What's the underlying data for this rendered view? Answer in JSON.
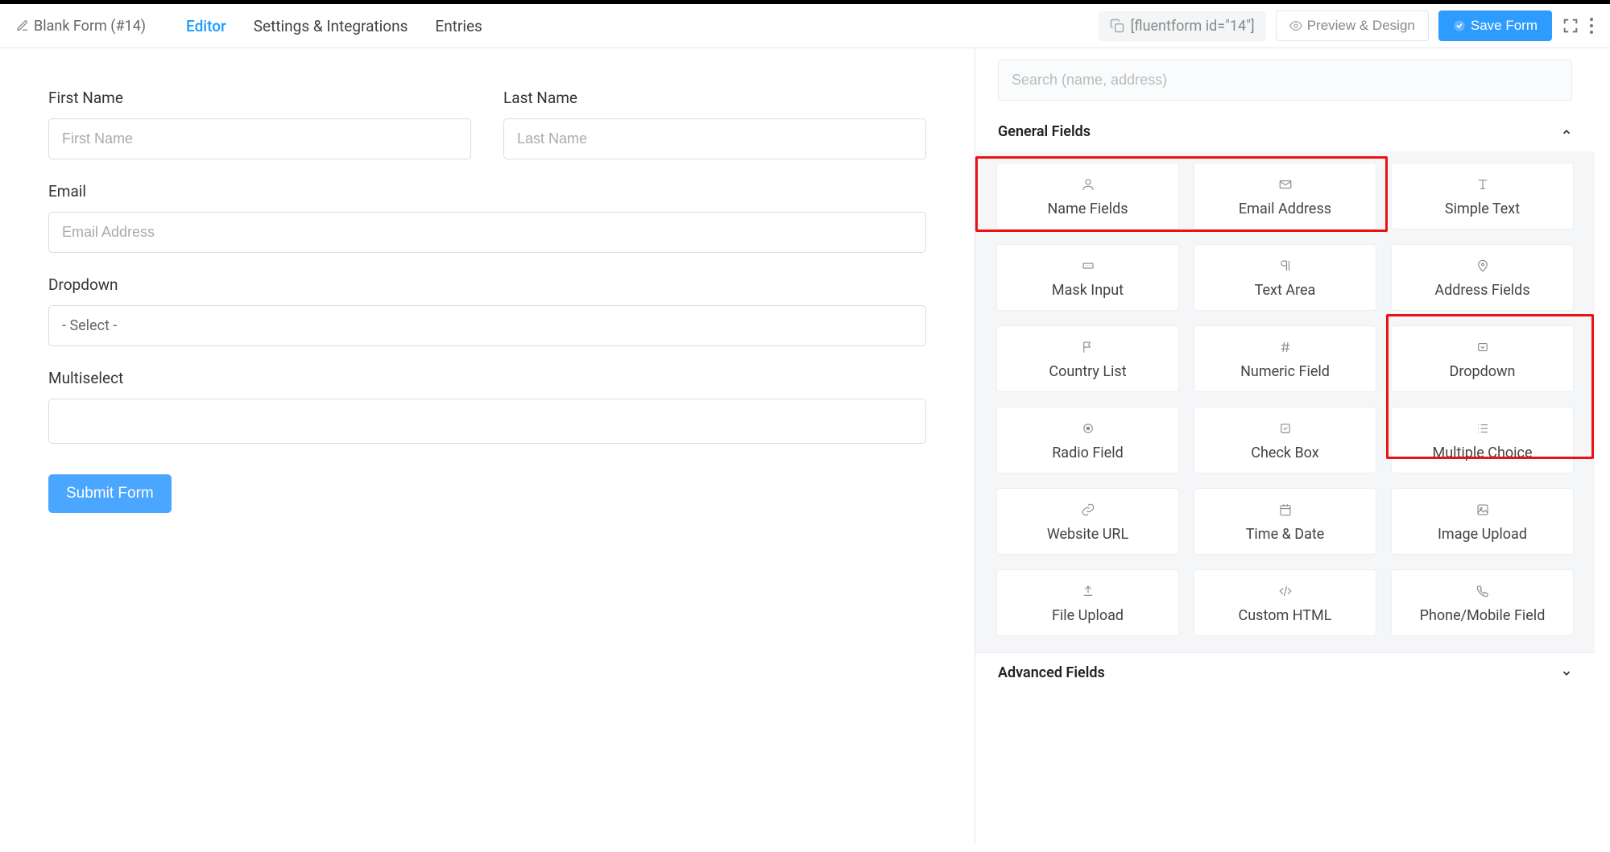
{
  "header": {
    "form_title": "Blank Form (#14)",
    "tabs": {
      "editor": "Editor",
      "settings": "Settings & Integrations",
      "entries": "Entries"
    },
    "shortcode": "[fluentform id=\"14\"]",
    "preview_label": "Preview & Design",
    "save_label": "Save Form"
  },
  "canvas": {
    "first_name_label": "First Name",
    "first_name_placeholder": "First Name",
    "last_name_label": "Last Name",
    "last_name_placeholder": "Last Name",
    "email_label": "Email",
    "email_placeholder": "Email Address",
    "dropdown_label": "Dropdown",
    "dropdown_value": "- Select -",
    "multiselect_label": "Multiselect",
    "submit_label": "Submit Form"
  },
  "sidebar": {
    "search_placeholder": "Search (name, address)",
    "general_fields_title": "General Fields",
    "advanced_fields_title": "Advanced Fields",
    "fields": {
      "name_fields": "Name Fields",
      "email_address": "Email Address",
      "simple_text": "Simple Text",
      "mask_input": "Mask Input",
      "text_area": "Text Area",
      "address_fields": "Address Fields",
      "country_list": "Country List",
      "numeric_field": "Numeric Field",
      "dropdown": "Dropdown",
      "radio_field": "Radio Field",
      "check_box": "Check Box",
      "multiple_choice": "Multiple Choice",
      "website_url": "Website URL",
      "time_date": "Time & Date",
      "image_upload": "Image Upload",
      "file_upload": "File Upload",
      "custom_html": "Custom HTML",
      "phone_mobile": "Phone/Mobile Field"
    }
  }
}
